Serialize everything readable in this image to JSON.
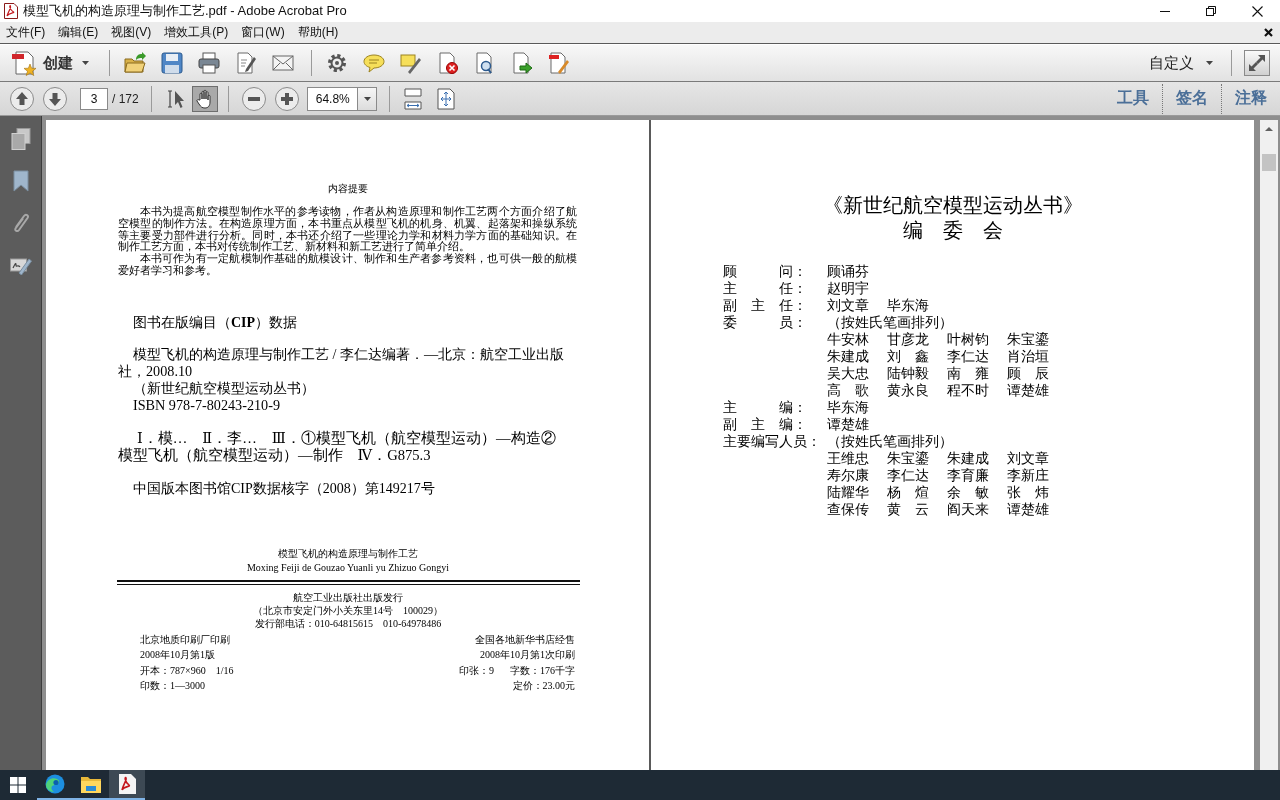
{
  "window": {
    "title": "模型飞机的构造原理与制作工艺.pdf - Adobe Acrobat Pro"
  },
  "menu_bar": {
    "items": [
      "文件(F)",
      "编辑(E)",
      "视图(V)",
      "增效工具(P)",
      "窗口(W)",
      "帮助(H)"
    ]
  },
  "toolbar": {
    "create_button": "创建",
    "customize_button": "自定义"
  },
  "nav_bar": {
    "page": "3",
    "page_count": "/ 172",
    "tools": [
      {
        "selected": false
      },
      {
        "selected": true
      }
    ],
    "zoom": "64.8%",
    "panes": [
      "工具",
      "签名",
      "注释"
    ]
  },
  "left_page": {
    "summary": {
      "heading": "内容提要",
      "paragraphs": [
        "本书为提高航空模型制作水平的参考读物，作者从构造原理和制作工艺两个方面介绍了航空模型的制作方法。在构造原理方面，本书重点从模型飞机的机身、机翼、起落架和操纵系统等主要受力部件进行分析。同时，本书还介绍了一些理论力学和材料力学方面的基础知识。在制作工艺方面，本书对传统制作工艺、新材料和新工艺进行了简单介绍。",
        "本书可作为有一定航模制作基础的航模设计、制作和生产者参考资料，也可供一般的航模爱好者学习和参考。"
      ]
    },
    "cip": {
      "heading": "图书在版编目（**CIP**）数据",
      "entries": [
        "模型飞机的构造原理与制作工艺 / 李仁达编著．—北京：航空工业出版社，2008.10",
        "（新世纪航空模型运动丛书）",
        "ISBN 978-7-80243-210-9"
      ],
      "classification": "Ⅰ．模…　Ⅱ．李…　Ⅲ．①模型飞机（航空模型运动）—构造②模型飞机（航空模型运动）—制作　Ⅳ．G875.3",
      "record": "中国版本图书馆CIP数据核字（2008）第149217号"
    },
    "colophon": {
      "title": "模型飞机的构造原理与制作工艺",
      "title_pinyin": "Moxing Feiji de Gouzao Yuanli yu Zhizuo Gongyi",
      "publisher_lines": [
        "航空工业出版社出版发行",
        "（北京市安定门外小关东里14号　100029）",
        "发行部电话：010-64815615　010-64978486"
      ],
      "rows": [
        {
          "left": "北京地质印刷厂印刷",
          "right": [
            "全国各地新华书店经售"
          ]
        },
        {
          "left": "2008年10月第1版",
          "right": [
            "2008年10月第1次印刷"
          ]
        },
        {
          "left": "开本：787×960　1/16",
          "right": [
            "印张：9",
            "字数：176千字"
          ]
        },
        {
          "left": "印数：1—3000",
          "right": [
            "定价：23.00元"
          ]
        }
      ]
    }
  },
  "right_page": {
    "series_title": "《新世纪航空模型运动丛书》",
    "heading": "编　委　会",
    "roles": [
      {
        "label": "顾　　　问：",
        "names": [
          "顾诵芬"
        ]
      },
      {
        "label": "主　　　任：",
        "names": [
          "赵明宇"
        ]
      },
      {
        "label": "副　主　任：",
        "names": [
          "刘文章",
          "毕东海"
        ]
      },
      {
        "label": "委　　　员：",
        "note": "（按姓氏笔画排列）",
        "names": [
          "牛安林",
          "甘彦龙",
          "叶树钧",
          "朱宝鎏",
          "朱建成",
          "刘　鑫",
          "李仁达",
          "肖治垣",
          "吴大忠",
          "陆钟毅",
          "南　雍",
          "顾　辰",
          "高　歌",
          "黄永良",
          "程不时",
          "谭楚雄"
        ]
      },
      {
        "label": "主　　　编：",
        "names": [
          "毕东海"
        ]
      },
      {
        "label": "副　主　编：",
        "names": [
          "谭楚雄"
        ]
      },
      {
        "label": "主要编写人员：",
        "note": "（按姓氏笔画排列）",
        "names": [
          "王维忠",
          "朱宝鎏",
          "朱建成",
          "刘文章",
          "寿尔康",
          "李仁达",
          "李育廉",
          "李新庄",
          "陆耀华",
          "杨　煊",
          "余　敏",
          "张　炜",
          "查保传",
          "黄　云",
          "阎天来",
          "谭楚雄"
        ]
      }
    ]
  },
  "taskbar": {
    "apps": [
      {
        "running": true,
        "selected": false
      },
      {
        "running": true,
        "selected": false
      },
      {
        "running": true,
        "selected": true
      }
    ]
  }
}
